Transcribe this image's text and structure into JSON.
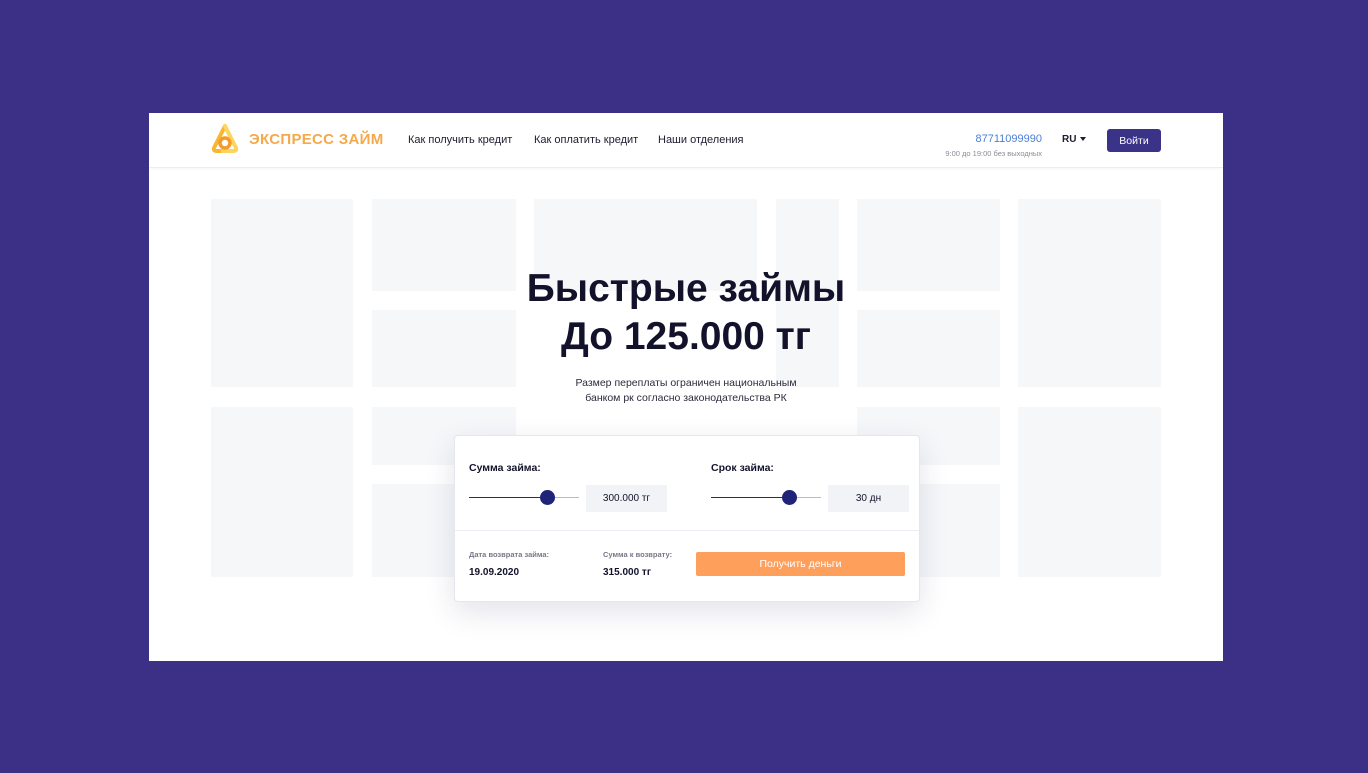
{
  "header": {
    "brand": "ЭКСПРЕСС ЗАЙМ",
    "nav": [
      "Как получить кредит",
      "Как оплатить кредит",
      "Наши отделения"
    ],
    "phone": "87711099990",
    "hours": "9:00 до 19:00 без выходных",
    "lang": "RU",
    "login": "Войти"
  },
  "hero": {
    "title_line1": "Быстрые займы",
    "title_line2": "До 125.000 тг",
    "subtitle_line1": "Размер переплаты ограничен национальным",
    "subtitle_line2": "банком рк согласно законодательства РК"
  },
  "calculator": {
    "amount_label": "Сумма займа:",
    "amount_value": "300.000 тг",
    "amount_slider_fraction": 0.71,
    "term_label": "Срок займа:",
    "term_value": "30 дн",
    "term_slider_fraction": 0.71,
    "return_date_label": "Дата возврата займа:",
    "return_date": "19.09.2020",
    "return_sum_label": "Сумма к возврату:",
    "return_sum": "315.000 тг",
    "submit": "Получить деньги"
  },
  "colors": {
    "background": "#3b2f86",
    "brand": "#f5a94a",
    "accent": "#3a3388",
    "cta": "#ff9f5c",
    "phone": "#4a7fd6"
  },
  "icons": {
    "logo": "express-zaim-logo-icon",
    "lang_caret": "caret-down-icon"
  }
}
